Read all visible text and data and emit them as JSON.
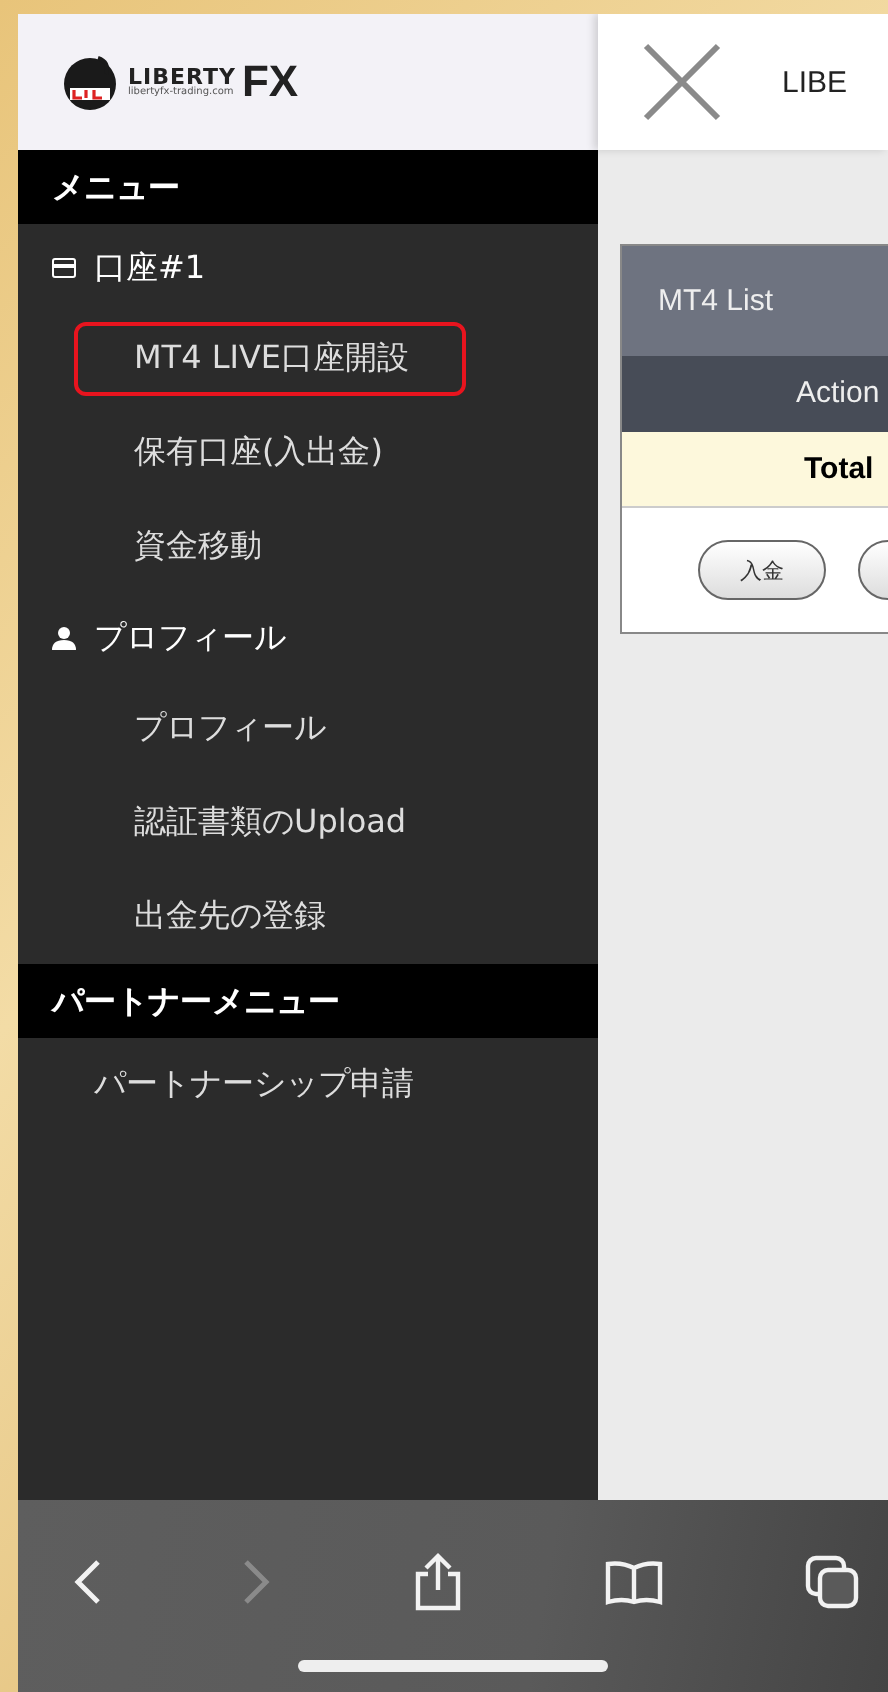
{
  "logo": {
    "brand": "LIBERTY",
    "domain": "libertyfx-trading.com",
    "mark": "FX"
  },
  "header": {
    "title": "LIBE"
  },
  "sidebar": {
    "sections": [
      {
        "title": "メニュー",
        "items": [
          {
            "kind": "group",
            "label": "口座#1",
            "children": [
              {
                "label": "MT4 LIVE口座開設",
                "selected": true
              },
              {
                "label": "保有口座(入出金)",
                "selected": false
              },
              {
                "label": "資金移動",
                "selected": false
              }
            ]
          },
          {
            "kind": "group",
            "label": "プロフィール",
            "children": [
              {
                "label": "プロフィール",
                "selected": false
              },
              {
                "label": "認証書類のUpload",
                "selected": false
              },
              {
                "label": "出金先の登録",
                "selected": false
              }
            ]
          }
        ]
      },
      {
        "title": "パートナーメニュー",
        "items": [
          {
            "kind": "link",
            "label": "パートナーシップ申請",
            "selected": false
          }
        ]
      }
    ]
  },
  "table": {
    "title": "MT4 List",
    "column": "Action",
    "total_label": "Total",
    "buttons": [
      "入金"
    ]
  },
  "toolbar": [
    {
      "kind": "back",
      "disabled": false
    },
    {
      "kind": "forward",
      "disabled": true
    },
    {
      "kind": "share",
      "disabled": false
    },
    {
      "kind": "bookmarks",
      "disabled": false
    },
    {
      "kind": "tabs",
      "disabled": false
    }
  ]
}
